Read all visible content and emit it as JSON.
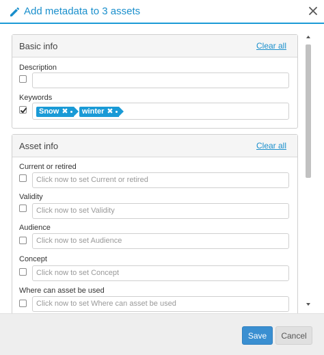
{
  "dialog": {
    "title": "Add metadata to 3 assets",
    "icons": {
      "edit": "pencil-icon",
      "close": "close-icon"
    }
  },
  "panels": {
    "basic": {
      "title": "Basic info",
      "clear_label": "Clear all",
      "fields": {
        "description": {
          "label": "Description",
          "checked": false,
          "value": ""
        },
        "keywords": {
          "label": "Keywords",
          "checked": true,
          "tags": [
            "Snow",
            "winter"
          ]
        }
      }
    },
    "asset": {
      "title": "Asset info",
      "clear_label": "Clear all",
      "fields": {
        "current": {
          "label": "Current or retired",
          "checked": false,
          "placeholder": "Click now to set Current or retired"
        },
        "validity": {
          "label": "Validity",
          "checked": false,
          "placeholder": "Click now to set Validity"
        },
        "audience": {
          "label": "Audience",
          "checked": false,
          "placeholder": "Click now to set Audience"
        },
        "concept": {
          "label": "Concept",
          "checked": false,
          "placeholder": "Click now to set Concept"
        },
        "where_used": {
          "label": "Where can asset be used",
          "checked": false,
          "placeholder": "Click now to set Where can asset be used"
        }
      }
    }
  },
  "footer": {
    "save_label": "Save",
    "cancel_label": "Cancel"
  },
  "colors": {
    "accent": "#1a9ad6",
    "save_button": "#3a8fd1",
    "footer_bg": "#eeeeee"
  }
}
